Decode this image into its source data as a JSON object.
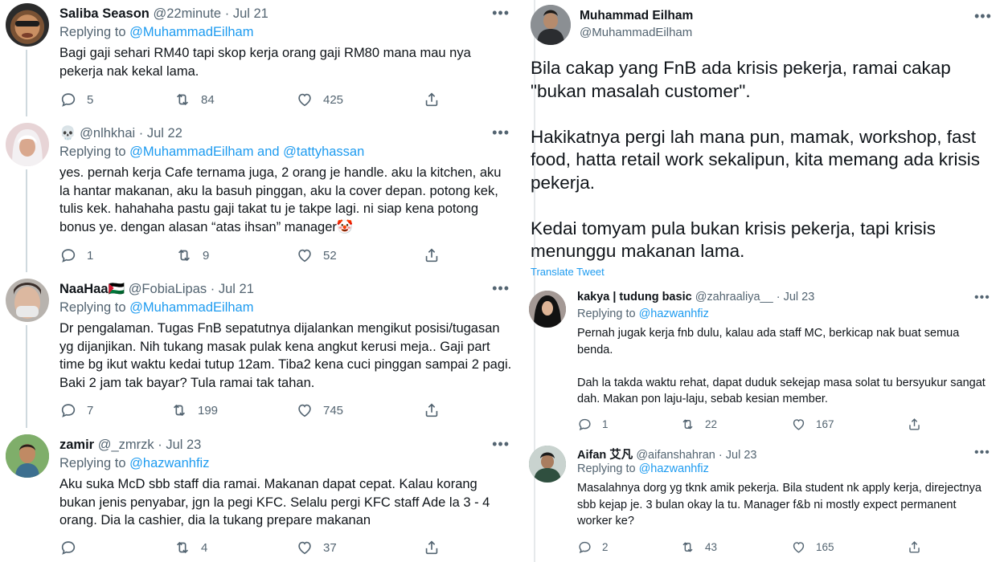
{
  "left_tweets": [
    {
      "name": "Saliba Season",
      "handle": "@22minute",
      "date": "Jul 21",
      "replying_prefix": "Replying to",
      "replying_to": "@MuhammadEilham",
      "text": "Bagi gaji sehari RM40 tapi skop kerja orang gaji RM80 mana mau nya pekerja nak kekal lama.",
      "replies": "5",
      "retweets": "84",
      "likes": "425"
    },
    {
      "name": "",
      "name_emoji": "💀",
      "handle": "@nlhkhai",
      "date": "Jul 22",
      "replying_prefix": "Replying to",
      "replying_to": "@MuhammadEilham and @tattyhassan",
      "text": "yes. pernah kerja Cafe ternama juga, 2 orang je handle. aku la kitchen, aku la hantar makanan, aku la basuh pinggan, aku la cover depan. potong kek, tulis kek. hahahaha pastu gaji takat tu je takpe lagi. ni siap kena potong bonus ye. dengan alasan “atas ihsan” manager🤡",
      "replies": "1",
      "retweets": "9",
      "likes": "52"
    },
    {
      "name": "NaaHaa",
      "name_emoji": "🇵🇸",
      "handle": "@FobiaLipas",
      "date": "Jul 21",
      "replying_prefix": "Replying to",
      "replying_to": "@MuhammadEilham",
      "text": "Dr pengalaman. Tugas FnB sepatutnya dijalankan mengikut posisi/tugasan yg dijanjikan. Nih tukang masak pulak kena angkut kerusi meja.. Gaji part time bg ikut waktu kedai tutup 12am. Tiba2 kena cuci pinggan sampai 2 pagi. Baki 2 jam tak bayar? Tula ramai tak tahan.",
      "replies": "7",
      "retweets": "199",
      "likes": "745"
    },
    {
      "name": "zamir",
      "handle": "@_zmrzk",
      "date": "Jul 23",
      "replying_prefix": "Replying to",
      "replying_to": "@hazwanhfiz",
      "text": "Aku suka McD sbb staff dia ramai. Makanan dapat cepat. Kalau korang bukan jenis penyabar, jgn la pegi KFC. Selalu pergi KFC staff Ade la 3 - 4 orang. Dia la cashier, dia la tukang prepare makanan",
      "replies": "",
      "retweets": "4",
      "likes": "37"
    }
  ],
  "main_tweet": {
    "name": "Muhammad Eilham",
    "handle": "@MuhammadEilham",
    "paragraphs": [
      "Bila cakap yang FnB ada krisis pekerja, ramai cakap \"bukan masalah customer\".",
      "Hakikatnya pergi lah mana pun, mamak, workshop, fast food, hatta retail work sekalipun, kita memang ada krisis pekerja.",
      "Kedai tomyam pula bukan krisis pekerja, tapi krisis menunggu makanan lama."
    ],
    "translate_label": "Translate Tweet"
  },
  "right_replies": [
    {
      "name": "kakya | tudung basic",
      "handle": "@zahraaliya__",
      "date": "Jul 23",
      "replying_prefix": "Replying to",
      "replying_to": "@hazwanhfiz",
      "paragraphs": [
        "Pernah jugak kerja fnb dulu, kalau ada staff MC, berkicap nak buat semua benda.",
        "Dah la takda waktu rehat, dapat duduk sekejap masa solat tu bersyukur sangat dah. Makan pon laju-laju, sebab kesian member."
      ],
      "replies": "1",
      "retweets": "22",
      "likes": "167"
    },
    {
      "name": "Aifan 艾凡",
      "handle": "@aifanshahran",
      "date": "Jul 23",
      "replying_prefix": "Replying to",
      "replying_to": "@hazwanhfiz",
      "paragraphs": [
        "Masalahnya dorg yg tknk amik pekerja. Bila student nk apply kerja, direjectnya sbb kejap je. 3 bulan okay la tu. Manager f&b ni mostly expect permanent worker ke?"
      ],
      "replies": "2",
      "retweets": "43",
      "likes": "165"
    }
  ],
  "icons": {
    "reply": "reply-icon",
    "retweet": "retweet-icon",
    "like": "heart-icon",
    "share": "share-icon",
    "more": "more-icon"
  },
  "colors": {
    "link": "#1d9bf0",
    "muted": "#536471",
    "text": "#0f1419"
  }
}
